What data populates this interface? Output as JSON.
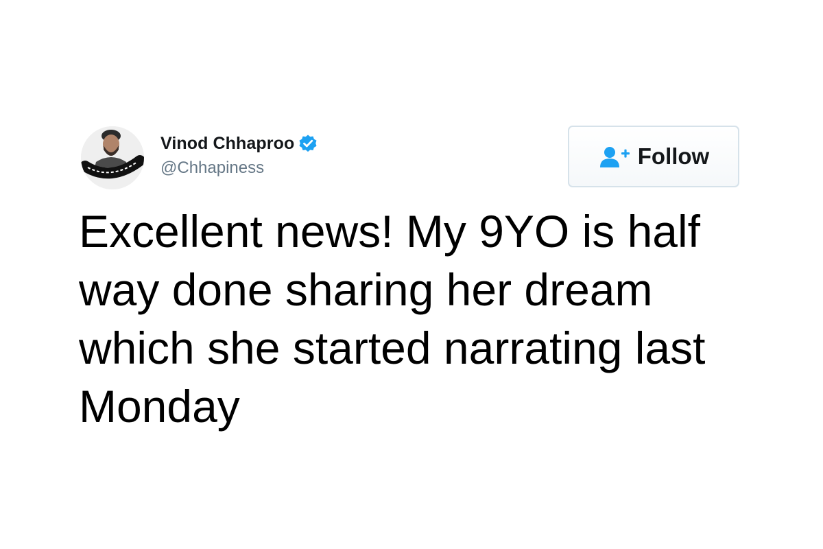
{
  "user": {
    "display_name": "Vinod Chhaproo",
    "handle": "@Chhapiness",
    "verified": true,
    "avatar_icon": "profile-photo-avatar",
    "avatar_logo_text": "Chhapiness"
  },
  "follow_button": {
    "label": "Follow",
    "icon": "add-user-icon",
    "icon_color": "#1da1f2"
  },
  "tweet": {
    "text": "Excellent news! My 9YO is half way done sharing her dream which she started narrating last Monday"
  },
  "colors": {
    "verified_badge": "#1da1f2",
    "handle_text": "#657786",
    "name_text": "#14171a",
    "button_border": "#d6e2ea"
  }
}
